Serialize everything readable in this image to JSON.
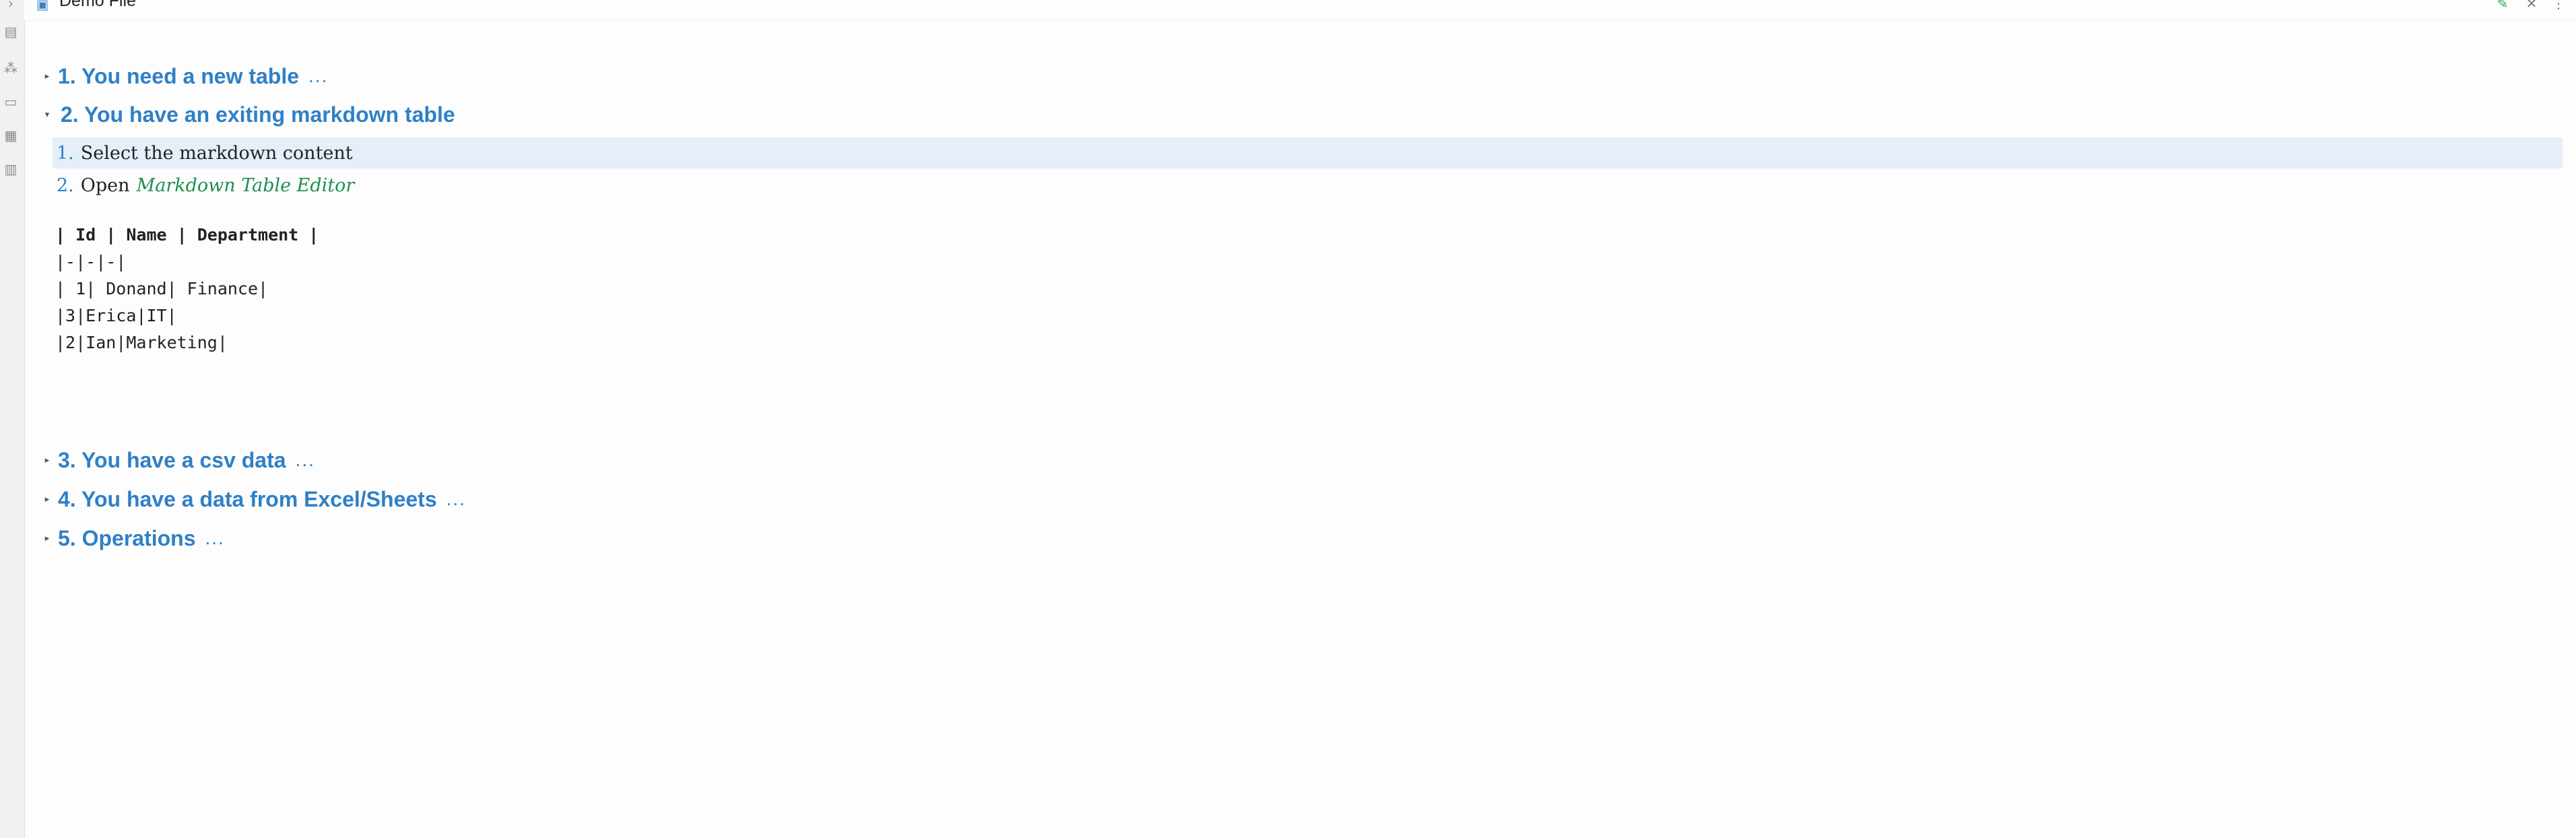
{
  "tab": {
    "title": "Demo File",
    "file_icon": "document-icon"
  },
  "window_controls": {
    "edit_icon": "pencil-icon",
    "close_icon": "close-icon",
    "more_icon": "more-icon"
  },
  "ribbon": {
    "icons": [
      "chevron-icon",
      "pages-icon",
      "graph-icon",
      "layers-icon",
      "blocks-icon",
      "table-icon"
    ]
  },
  "sections": [
    {
      "label": "1. You need a new table",
      "collapsed": true,
      "ellipsis": "..."
    },
    {
      "label": "2. You have an exiting markdown table",
      "collapsed": false,
      "ellipsis": ""
    },
    {
      "label": "3. You have a csv data",
      "collapsed": true,
      "ellipsis": "..."
    },
    {
      "label": "4. You have a data from Excel/Sheets",
      "collapsed": true,
      "ellipsis": "..."
    },
    {
      "label": "5. Operations",
      "collapsed": true,
      "ellipsis": "..."
    }
  ],
  "steps": [
    {
      "num": "1.",
      "text": "Select the markdown content"
    },
    {
      "num": "2.",
      "text": "Open",
      "link": "Markdown Table Editor"
    }
  ],
  "code_block": [
    "| Id | Name | Department |",
    "|-|-|-|",
    "| 1| Donand| Finance|",
    "|3|Erica|IT|",
    "|2|Ian|Marketing|"
  ]
}
